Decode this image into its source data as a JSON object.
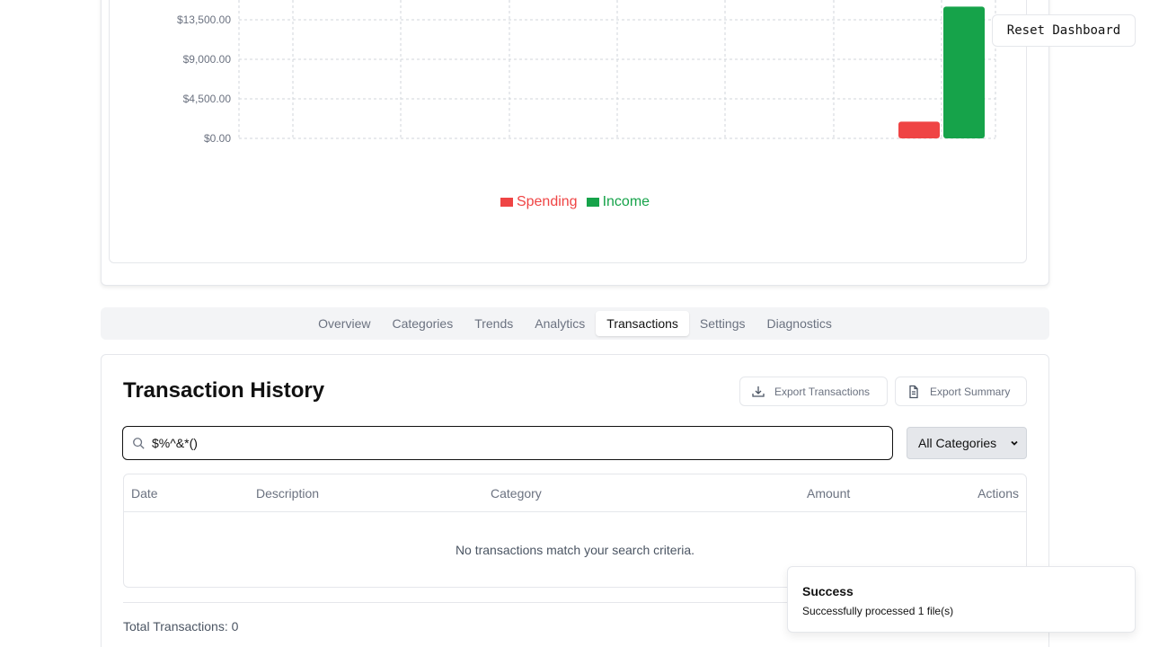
{
  "reset_button": {
    "label": "Reset Dashboard"
  },
  "chart_data": {
    "type": "bar",
    "yticks": [
      "$0.00",
      "$4,500.00",
      "$9,000.00",
      "$13,500.00"
    ],
    "ylim": [
      0,
      13500
    ],
    "categories": [
      "",
      "",
      "",
      "",
      "",
      "",
      ""
    ],
    "series": [
      {
        "name": "Spending",
        "color": "#ef4444",
        "values": [
          0,
          0,
          0,
          0,
          0,
          0,
          1900
        ]
      },
      {
        "name": "Income",
        "color": "#16a34a",
        "values": [
          0,
          0,
          0,
          0,
          0,
          0,
          15000
        ]
      }
    ],
    "legend": "bottom-center",
    "grid": true
  },
  "tabs": [
    {
      "label": "Overview",
      "active": false
    },
    {
      "label": "Categories",
      "active": false
    },
    {
      "label": "Trends",
      "active": false
    },
    {
      "label": "Analytics",
      "active": false
    },
    {
      "label": "Transactions",
      "active": true
    },
    {
      "label": "Settings",
      "active": false
    },
    {
      "label": "Diagnostics",
      "active": false
    }
  ],
  "transactions": {
    "title": "Transaction History",
    "export_transactions_label": "Export Transactions",
    "export_summary_label": "Export Summary",
    "search_value": "$%^&*()",
    "category_select": "All Categories",
    "columns": [
      "Date",
      "Description",
      "Category",
      "Amount",
      "Actions"
    ],
    "empty_message": "No transactions match your search criteria.",
    "total_label": "Total Transactions: 0"
  },
  "toast": {
    "title": "Success",
    "message": "Successfully processed 1 file(s)"
  }
}
